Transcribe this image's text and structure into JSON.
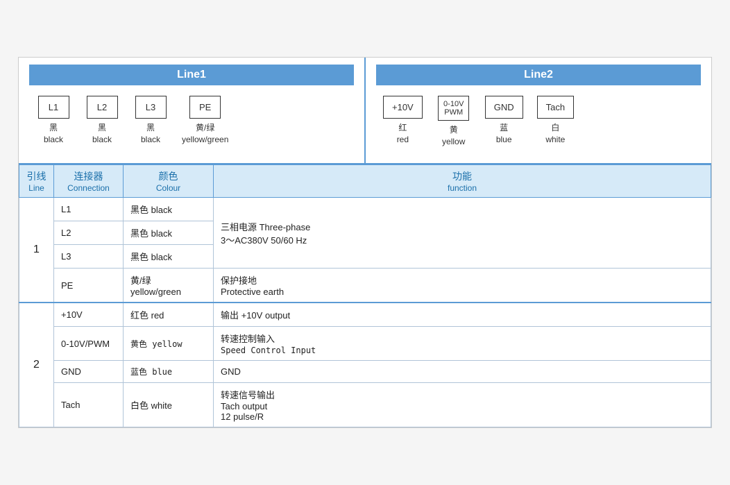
{
  "line1": {
    "header": "Line1",
    "connectors": [
      {
        "id": "L1",
        "label_ch": "黑",
        "label_en": "black"
      },
      {
        "id": "L2",
        "label_ch": "黑",
        "label_en": "black"
      },
      {
        "id": "L3",
        "label_ch": "黑",
        "label_en": "black"
      },
      {
        "id": "PE",
        "label_ch": "黄/绿",
        "label_en": "yellow/green"
      }
    ]
  },
  "line2": {
    "header": "Line2",
    "connectors": [
      {
        "id": "+10V",
        "label_ch": "红",
        "label_en": "red"
      },
      {
        "id": "0-10V\nPWM",
        "label_ch": "黄",
        "label_en": "yellow",
        "small": true
      },
      {
        "id": "GND",
        "label_ch": "蓝",
        "label_en": "blue"
      },
      {
        "id": "Tach",
        "label_ch": "白",
        "label_en": "white"
      }
    ]
  },
  "table": {
    "headers": {
      "line": {
        "ch": "引线",
        "en": "Line"
      },
      "connection": {
        "ch": "连接器",
        "en": "Connection"
      },
      "colour": {
        "ch": "颜色",
        "en": "Colour"
      },
      "function": {
        "ch": "功能",
        "en": "function"
      }
    },
    "rows": [
      {
        "line_group": "1",
        "line_rowspan": 4,
        "connection": "L1",
        "colour": "黑色 black",
        "function": "三相电源 Three-phase\n3～AC380V 50/60 Hz",
        "func_rowspan": 3
      },
      {
        "connection": "L2",
        "colour": "黑色 black"
      },
      {
        "connection": "L3",
        "colour": "黑色 black"
      },
      {
        "connection": "PE",
        "colour": "黄/绿\nyellow/green",
        "function": "保护接地\nProtective earth"
      },
      {
        "line_group": "2",
        "line_rowspan": 4,
        "connection": "+10V",
        "colour": "红色 red",
        "function": "输出 +10V output",
        "section_start": true
      },
      {
        "connection": "0-10V/PWM",
        "colour_mono": true,
        "colour": "黄色 yellow",
        "function": "转速控制输入\nSpeed Control Input"
      },
      {
        "connection": "GND",
        "colour_mono": true,
        "colour": "蓝色 blue",
        "function": "GND"
      },
      {
        "connection": "Tach",
        "colour": "白色 white",
        "function": "转速信号输出\nTach output\n12 pulse/R"
      }
    ]
  }
}
